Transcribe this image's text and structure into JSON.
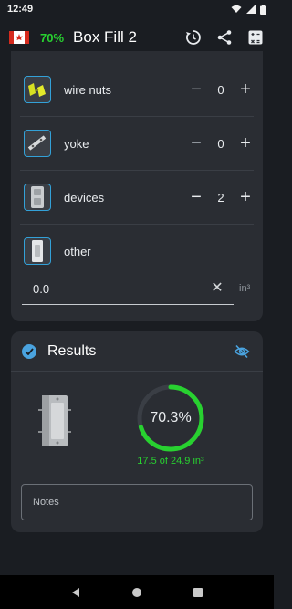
{
  "status": {
    "time": "12:49",
    "icons": [
      "wifi-icon",
      "signal-icon",
      "battery-icon"
    ]
  },
  "appbar": {
    "percent": "70%",
    "title": "Box Fill 2",
    "actions": [
      "history-icon",
      "share-icon",
      "calculator-icon"
    ]
  },
  "items": [
    {
      "label": "wire nuts",
      "count": "0",
      "icon": "wire-nut-icon"
    },
    {
      "label": "yoke",
      "count": "0",
      "icon": "yoke-icon"
    },
    {
      "label": "devices",
      "count": "2",
      "icon": "device-icon"
    },
    {
      "label": "other",
      "icon": "other-icon"
    }
  ],
  "volume": {
    "value": "0.0",
    "unit": "in³"
  },
  "results": {
    "title": "Results",
    "percent_text": "70.3%",
    "fill_fraction": 0.703,
    "summary": "17.5 of 24.9 in³",
    "notes_placeholder": "Notes"
  },
  "colors": {
    "accent_green": "#28d130",
    "accent_blue": "#33a1d8",
    "card": "#2a2d33",
    "background": "#1a1d22"
  }
}
